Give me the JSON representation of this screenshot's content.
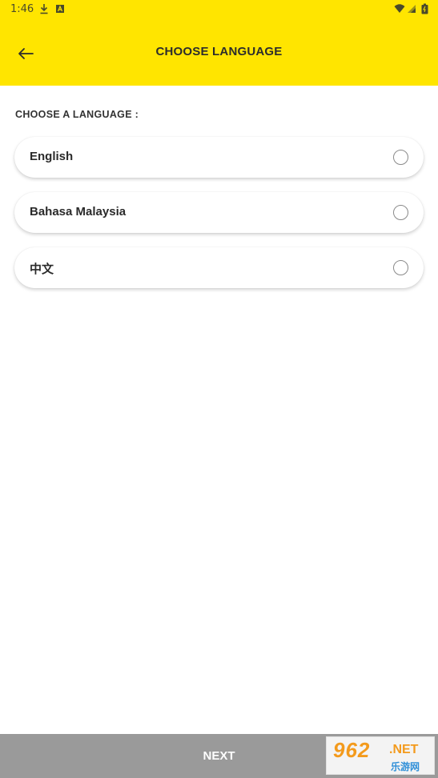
{
  "status_bar": {
    "time": "1:46",
    "icons": [
      "download-icon",
      "notification-a-icon",
      "wifi-icon",
      "signal-icon",
      "battery-icon"
    ]
  },
  "app_bar": {
    "title": "CHOOSE LANGUAGE",
    "back_icon": "arrow-left-icon"
  },
  "main": {
    "section_label": "CHOOSE A LANGUAGE :",
    "languages": [
      {
        "label": "English",
        "selected": false
      },
      {
        "label": "Bahasa Malaysia",
        "selected": false
      },
      {
        "label": "中文",
        "selected": false
      }
    ]
  },
  "footer": {
    "next_label": "NEXT"
  },
  "watermark": {
    "logo": "962",
    "net": ".NET",
    "sub": "乐游网"
  },
  "colors": {
    "header_bg": "#FFE500",
    "footer_bg": "#9a9a9a"
  }
}
